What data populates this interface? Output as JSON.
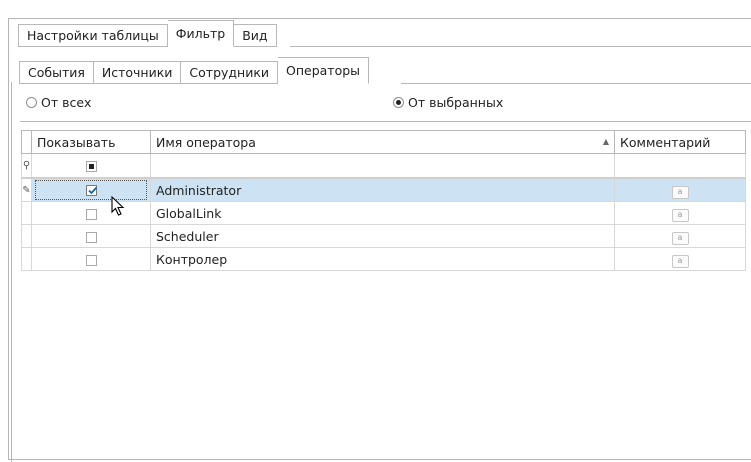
{
  "top_tabs": [
    {
      "label": "Настройки таблицы",
      "active": false
    },
    {
      "label": "Фильтр",
      "active": true
    },
    {
      "label": "Вид",
      "active": false
    }
  ],
  "sub_tabs": [
    {
      "label": "События",
      "active": false
    },
    {
      "label": "Источники",
      "active": false
    },
    {
      "label": "Сотрудники",
      "active": false
    },
    {
      "label": "Операторы",
      "active": true
    }
  ],
  "radio": {
    "from_all": "От всех",
    "from_selected": "От выбранных",
    "selected": "from_selected"
  },
  "grid": {
    "columns": {
      "show": "Показывать",
      "name": "Имя оператора",
      "comment": "Комментарий"
    },
    "sort_column": "name",
    "rows": [
      {
        "name": "Administrator",
        "checked": true,
        "selected": true
      },
      {
        "name": "GlobalLink",
        "checked": false,
        "selected": false
      },
      {
        "name": "Scheduler",
        "checked": false,
        "selected": false
      },
      {
        "name": "Контролер",
        "checked": false,
        "selected": false
      }
    ],
    "memo_icon": "memo-icon",
    "filter_row_icon": "pin-icon",
    "edit_row_icon": "pencil-icon"
  },
  "colors": {
    "selection": "#cde3f4",
    "border": "#b8b8b8"
  }
}
